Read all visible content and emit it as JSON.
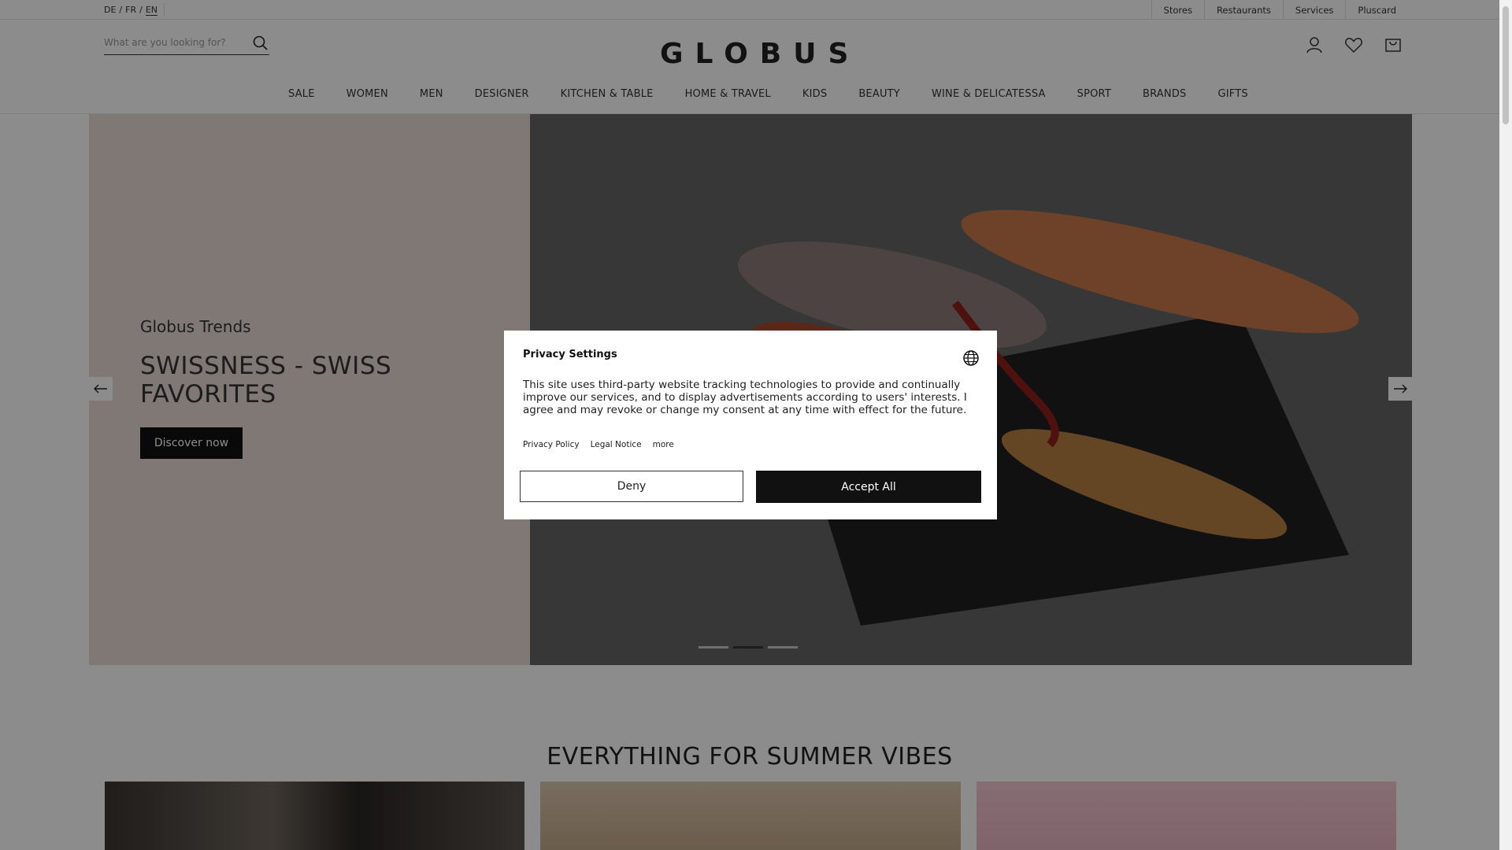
{
  "languages": [
    {
      "code": "DE",
      "active": false
    },
    {
      "code": "FR",
      "active": false
    },
    {
      "code": "EN",
      "active": true
    }
  ],
  "lang_separator": "/",
  "top_links": [
    "Stores",
    "Restaurants",
    "Services",
    "Pluscard"
  ],
  "search": {
    "placeholder": "What are you looking for?"
  },
  "logo": "GLOBUS",
  "header_icons": [
    "user-icon",
    "heart-icon",
    "bag-icon"
  ],
  "nav": [
    "SALE",
    "WOMEN",
    "MEN",
    "DESIGNER",
    "KITCHEN & TABLE",
    "HOME & TRAVEL",
    "KIDS",
    "BEAUTY",
    "WINE & DELICATESSA",
    "SPORT",
    "BRANDS",
    "GIFTS"
  ],
  "hero": {
    "eyebrow": "Globus Trends",
    "title": "SWISSNESS - SWISS FAVORITES",
    "cta": "Discover now",
    "slide_count": 3,
    "active_slide": 2
  },
  "section": {
    "title": "EVERYTHING FOR SUMMER VIBES"
  },
  "privacy": {
    "title": "Privacy Settings",
    "text": "This site uses third-party website tracking technologies to provide and continually improve our services, and to display advertisements according to users' interests. I agree and may revoke or change my consent at any time with effect for the future.",
    "links": [
      "Privacy Policy",
      "Legal Notice",
      "more"
    ],
    "deny": "Deny",
    "accept": "Accept All"
  },
  "colors": {
    "accent": "#111111",
    "hero_bg": "#e8dbd6",
    "overlay": "rgba(0,0,0,0.45)"
  }
}
